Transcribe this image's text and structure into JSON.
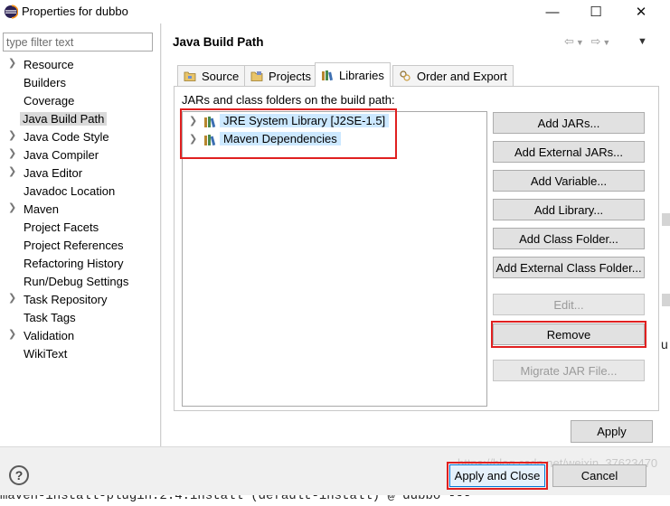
{
  "window": {
    "title": "Properties for dubbo",
    "minimize_icon": "—",
    "maximize_icon": "☐",
    "close_icon": "✕"
  },
  "sidebar": {
    "filter_placeholder": "type filter text",
    "items": [
      {
        "label": "Resource",
        "expandable": true
      },
      {
        "label": "Builders",
        "expandable": false
      },
      {
        "label": "Coverage",
        "expandable": false
      },
      {
        "label": "Java Build Path",
        "expandable": false,
        "selected": true
      },
      {
        "label": "Java Code Style",
        "expandable": true
      },
      {
        "label": "Java Compiler",
        "expandable": true
      },
      {
        "label": "Java Editor",
        "expandable": true
      },
      {
        "label": "Javadoc Location",
        "expandable": false
      },
      {
        "label": "Maven",
        "expandable": true
      },
      {
        "label": "Project Facets",
        "expandable": false
      },
      {
        "label": "Project References",
        "expandable": false
      },
      {
        "label": "Refactoring History",
        "expandable": false
      },
      {
        "label": "Run/Debug Settings",
        "expandable": false
      },
      {
        "label": "Task Repository",
        "expandable": true
      },
      {
        "label": "Task Tags",
        "expandable": false
      },
      {
        "label": "Validation",
        "expandable": true
      },
      {
        "label": "WikiText",
        "expandable": false
      }
    ]
  },
  "page": {
    "title": "Java Build Path",
    "tabs": [
      {
        "label": "Source",
        "icon": "source-folder-icon"
      },
      {
        "label": "Projects",
        "icon": "projects-icon"
      },
      {
        "label": "Libraries",
        "icon": "libraries-icon",
        "active": true
      },
      {
        "label": "Order and Export",
        "icon": "order-export-icon"
      }
    ],
    "jars_label": "JARs and class folders on the build path:",
    "libraries": [
      {
        "label": "JRE System Library [J2SE-1.5]"
      },
      {
        "label": "Maven Dependencies"
      }
    ],
    "buttons": {
      "add_jars": "Add JARs...",
      "add_external_jars": "Add External JARs...",
      "add_variable": "Add Variable...",
      "add_library": "Add Library...",
      "add_class_folder": "Add Class Folder...",
      "add_external_class_folder": "Add External Class Folder...",
      "edit": "Edit...",
      "remove": "Remove",
      "migrate_jar": "Migrate JAR File...",
      "apply": "Apply"
    }
  },
  "footer": {
    "help": "?",
    "apply_and_close": "Apply and Close",
    "cancel": "Cancel"
  },
  "background": {
    "bottom_text": "maven-install-plugin:2.4:install (default-install) @ dubbo ---",
    "right_edge_text": "u",
    "watermark": "https://blog.csdn.net/weixin_37623470"
  },
  "colors": {
    "highlight_red": "#e02020",
    "selection_blue": "#cce8ff",
    "default_button_border": "#0078d7"
  }
}
